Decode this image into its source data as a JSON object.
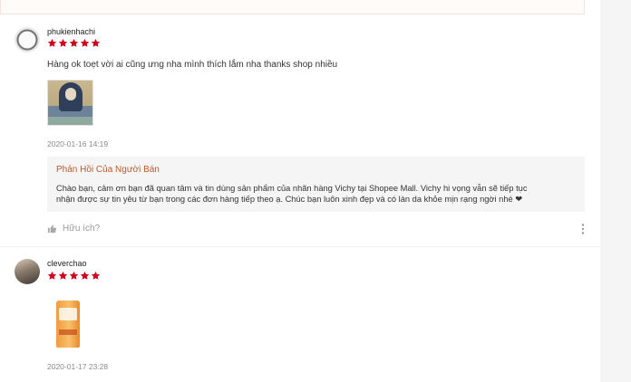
{
  "reviews": [
    {
      "username": "phukienhachi",
      "rating": 5,
      "comment": "Hàng ok toẹt vời ai cũng ưng nha mình thích lắm nha thanks shop nhiều",
      "date": "2020-01-16 14:19",
      "seller_reply": {
        "title": "Phản Hồi Của Người Bán",
        "text": "Chào bạn, cảm ơn bạn đã quan tâm và tin dùng sản phẩm của nhãn hàng Vichy tại Shopee Mall. Vichy hi vọng vẫn sẽ tiếp tục\nnhận được sự tin yêu từ bạn trong các đơn hàng tiếp theo ạ. Chúc bạn luôn xinh đẹp và có làn da khỏe mịn rạng ngời nhé ❤"
      },
      "helpful_label": "Hữu ích?"
    },
    {
      "username": "cleverchao",
      "rating": 5,
      "date": "2020-01-17 23:28"
    }
  ],
  "colors": {
    "star": "#d0011b",
    "reply_title": "#b85a2a"
  },
  "icons": [
    "star-icon",
    "thumbs-up-icon",
    "more-vertical-icon"
  ]
}
